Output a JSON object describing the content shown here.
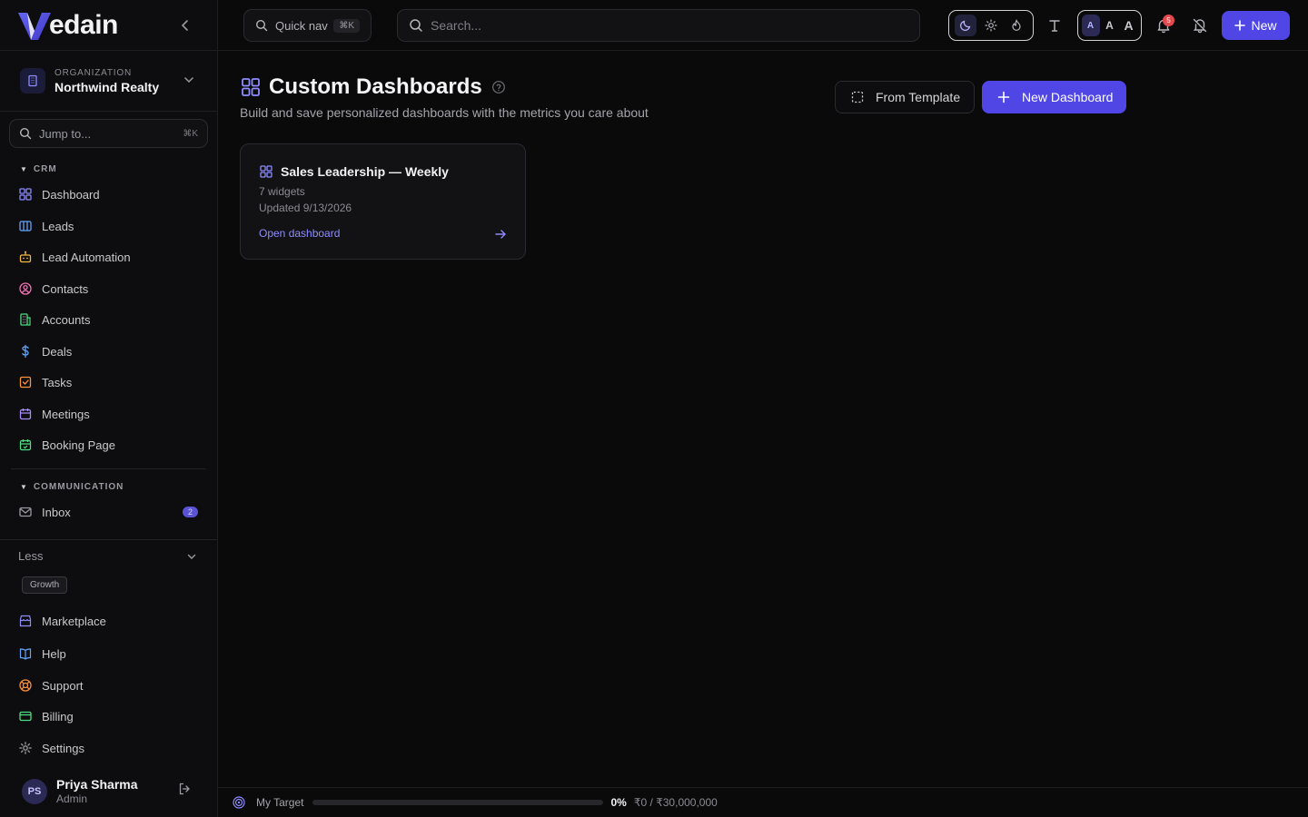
{
  "brand": {
    "logo_letter": "V",
    "logo_rest": "edain"
  },
  "organization": {
    "label": "ORGANIZATION",
    "name": "Northwind Realty"
  },
  "jump": {
    "placeholder": "Jump to...",
    "shortcut": "⌘K"
  },
  "sidebar": {
    "crm_label": "CRM",
    "crm_items": [
      {
        "label": "Dashboard",
        "icon": "grid-icon"
      },
      {
        "label": "Leads",
        "icon": "columns-icon"
      },
      {
        "label": "Lead Automation",
        "icon": "bot-icon"
      },
      {
        "label": "Contacts",
        "icon": "user-circle-icon"
      },
      {
        "label": "Accounts",
        "icon": "building-icon"
      },
      {
        "label": "Deals",
        "icon": "dollar-icon"
      },
      {
        "label": "Tasks",
        "icon": "checkbox-icon"
      },
      {
        "label": "Meetings",
        "icon": "calendar-icon"
      },
      {
        "label": "Booking Page",
        "icon": "calendar-check-icon"
      }
    ],
    "communication_label": "COMMUNICATION",
    "inbox": {
      "label": "Inbox",
      "badge": "2"
    },
    "less_label": "Less",
    "growth_tag": "Growth",
    "bottom_items": [
      {
        "label": "Marketplace",
        "icon": "store-icon"
      },
      {
        "label": "Help",
        "icon": "book-icon"
      },
      {
        "label": "Support",
        "icon": "lifebuoy-icon"
      },
      {
        "label": "Billing",
        "icon": "card-icon"
      },
      {
        "label": "Settings",
        "icon": "gear-icon"
      }
    ]
  },
  "user": {
    "initials": "PS",
    "name": "Priya Sharma",
    "role": "Admin"
  },
  "topbar": {
    "quicknav_label": "Quick nav",
    "quicknav_shortcut": "⌘K",
    "search_placeholder": "Search...",
    "font_sizes": [
      "A",
      "A",
      "A"
    ],
    "notification_count": "5",
    "new_label": "New"
  },
  "main": {
    "title": "Custom Dashboards",
    "subtitle": "Build and save personalized dashboards with the metrics you care about",
    "from_template_label": "From Template",
    "new_dashboard_label": "New Dashboard"
  },
  "dashboards": [
    {
      "title": "Sales Leadership — Weekly",
      "widgets": "7 widgets",
      "updated": "Updated 9/13/2026",
      "open_label": "Open dashboard"
    }
  ],
  "target": {
    "label": "My Target",
    "percent_text": "0%",
    "progress": 0,
    "amount": "₹0 / ₹30,000,000"
  },
  "colors": {
    "accent": "#4f46e5",
    "background": "#0a0a0b",
    "badge_red": "#e5484d"
  }
}
